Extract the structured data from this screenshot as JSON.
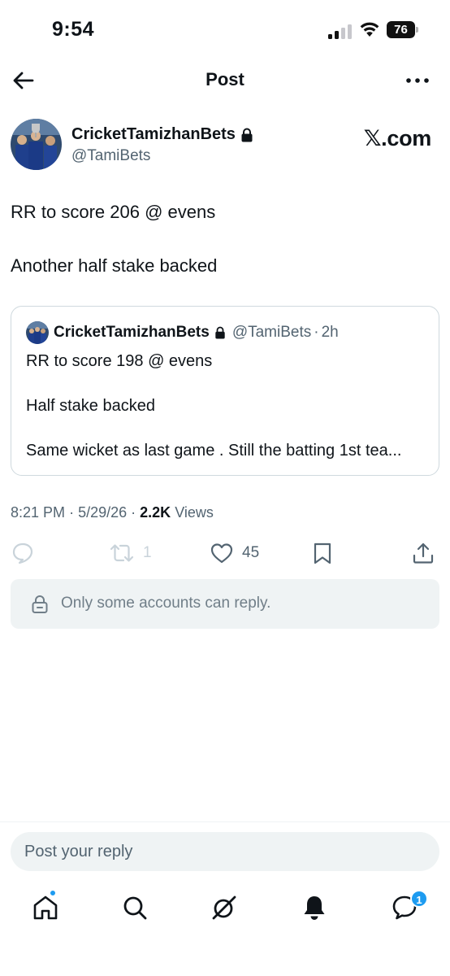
{
  "status_bar": {
    "time": "9:54",
    "battery": "76",
    "icons": [
      "signal-icon",
      "wifi-icon",
      "battery-icon"
    ]
  },
  "header": {
    "title": "Post",
    "back_icon": "arrow-left-icon",
    "more_icon": "more-horizontal-icon"
  },
  "post": {
    "author_name": "CricketTamizhanBets",
    "author_handle": "@TamiBets",
    "brand": "𝕏.com",
    "lines": [
      "RR to score 206  @ evens",
      "Another half stake backed"
    ],
    "quoted": {
      "author_name": "CricketTamizhanBets",
      "author_handle": "@TamiBets",
      "time": "2h",
      "lines": [
        "RR to score 198  @ evens",
        "Half stake backed",
        "Same wicket as last game . Still the batting 1st tea..."
      ]
    },
    "meta": {
      "time": "8:21 PM",
      "date": "5/29/26",
      "views_count": "2.2K",
      "views_label": "Views"
    },
    "actions": {
      "reply_icon": "reply-icon",
      "repost_icon": "repost-icon",
      "repost_count": "1",
      "like_icon": "heart-icon",
      "like_count": "45",
      "bookmark_icon": "bookmark-icon",
      "share_icon": "share-icon"
    },
    "restriction": "Only some accounts can reply."
  },
  "reply_bar": {
    "placeholder": "Post your reply"
  },
  "nav": {
    "items": [
      "home-icon",
      "search-icon",
      "grok-icon",
      "notifications-icon",
      "messages-icon"
    ],
    "messages_badge": "1"
  },
  "colors": {
    "text": "#0f1419",
    "secondary": "#536471",
    "accent": "#1d9bf0",
    "border": "#cfd9de",
    "surface": "#eff3f4"
  }
}
